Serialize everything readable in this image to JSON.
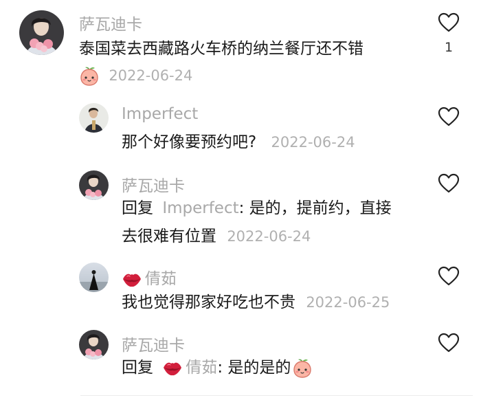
{
  "comments": [
    {
      "author": "萨瓦迪卡",
      "text": "泰国菜去西藏路火车桥的纳兰餐厅还不错",
      "date": "2022-06-24",
      "likes": "1"
    }
  ],
  "replies": [
    {
      "author": "Imperfect",
      "text": "那个好像要预约吧?",
      "date": "2022-06-24"
    },
    {
      "author": "萨瓦迪卡",
      "reply_prefix": "回复",
      "mention": "Imperfect",
      "text_line1": ": 是的，提前约，直接",
      "text_line2": "去很难有位置",
      "date": "2022-06-24"
    },
    {
      "author": "倩茹",
      "text": "我也觉得那家好吃也不贵",
      "date": "2022-06-25"
    },
    {
      "author": "萨瓦迪卡",
      "reply_prefix": "回复",
      "mention": "倩茹",
      "text": ": 是的是的"
    }
  ],
  "icons": {
    "like": "heart-outline-icon",
    "peach": "peach-emoji-icon",
    "lips": "lips-emoji-icon"
  }
}
